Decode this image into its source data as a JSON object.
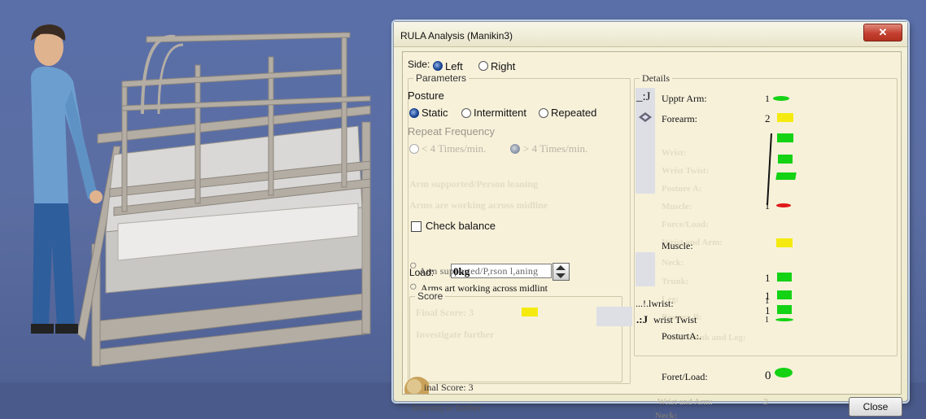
{
  "dialog": {
    "title": "RULA Analysis (Manikin3)",
    "close_x": "✕",
    "close_button": "Close"
  },
  "side": {
    "label": "Side:",
    "left": "Left",
    "right": "Right",
    "selected": "Left"
  },
  "parameters": {
    "title": "Parameters",
    "posture_label": "Posture",
    "posture_options": [
      "Static",
      "Intermittent",
      "Repeated"
    ],
    "posture_selected": "Static",
    "repeat_label": "Repeat Frequency",
    "repeat_options": [
      "< 4 Times/min.",
      "> 4 Times/min."
    ],
    "repeat_selected": "> 4 Times/min.",
    "ghost_1": "Arm supported/Person leaning",
    "ghost_2": "Arms are working across midline",
    "check_balance": "Check balance",
    "load_label": "Load:",
    "load_value": "0kg",
    "load_overlap": "Arm supported/P,rson l,aning",
    "arms_overlap": "Arms art working across midlint"
  },
  "score": {
    "title": "Score",
    "ghost_final": "Final Score: 3",
    "ghost_investigate": "Investigate further",
    "final_score": "inal Score: 3",
    "investigate": "Investiq te further"
  },
  "details": {
    "title": "Details",
    "upper_arm": "Upptr Arm:",
    "upper_arm_marker": "_:J",
    "upper_arm_value": "1",
    "forearm": "Forearm:",
    "forearm_value": "2",
    "ghost_rows": [
      "Wrist:",
      "Wrist Twist:",
      "Posture A:",
      "Muscle:",
      "Force/Load:",
      "Wrist and Arm:",
      "Neck:",
      "Trunk:",
      "Leg:",
      "Posture B:",
      "Neck, Trunk and Leg:"
    ],
    "wrist_value": "1",
    "muscle": "Muscle:",
    "val_1": "1",
    "val_2": "1",
    "wrist": "...!.lwrist:",
    "wrist_marker": "1",
    "wrist_value_2": "1",
    "wrist_twist_marker": ".:J",
    "wrist_twist": "wrist Twist",
    "wrist_twist_value": "1",
    "posture_a": "PosturtA:.",
    "force_load": "Foret/Load:",
    "force_load_value": "0",
    "wrist_and_arm": "Wrist and Arm:",
    "wrist_and_arm_value": "3",
    "neck_fragment": "Neck:"
  },
  "colors": {
    "green": "#14d214",
    "yellow": "#f5ea10",
    "red": "#e01818",
    "viewport_bg": "#5a6fa8"
  }
}
